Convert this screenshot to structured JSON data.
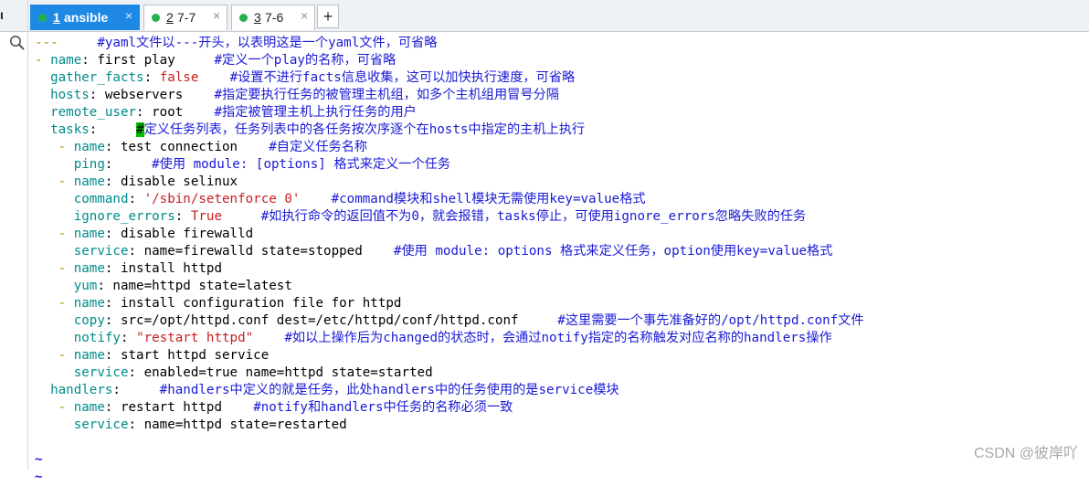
{
  "left_strip": {
    "cut_text": "ι"
  },
  "tabs": [
    {
      "num": "1",
      "label": "ansible",
      "close": "×",
      "active": true
    },
    {
      "num": "2",
      "label": "7-7",
      "close": "×",
      "active": false
    },
    {
      "num": "3",
      "label": "7-6",
      "close": "×",
      "active": false
    }
  ],
  "add_tab": "+",
  "editor": {
    "l01_dash": "---",
    "l01_cm": "     #yaml文件以---开头，以表明这是一个yaml文件，可省略",
    "l02_dash": "- ",
    "l02_key": "name",
    "l02_val": ": first play     ",
    "l02_cm": "#定义一个play的名称，可省略",
    "l03_key": "  gather_facts",
    "l03_colon": ": ",
    "l03_red": "false",
    "l03_cm": "    #设置不进行facts信息收集，这可以加快执行速度，可省略",
    "l04_key": "  hosts",
    "l04_val": ": webservers    ",
    "l04_cm": "#指定要执行任务的被管理主机组，如多个主机组用冒号分隔",
    "l05_key": "  remote_user",
    "l05_val": ": root    ",
    "l05_cm": "#指定被管理主机上执行任务的用户",
    "l06_key": "  tasks",
    "l06_val": ":     ",
    "l06_cursor": "#",
    "l06_cm": "定义任务列表，任务列表中的各任务按次序逐个在hosts中指定的主机上执行",
    "l07_dash": "   - ",
    "l07_key": "name",
    "l07_val": ": test connection    ",
    "l07_cm": "#自定义任务名称",
    "l08_key": "     ping",
    "l08_val": ":     ",
    "l08_cm": "#使用 module: [options] 格式来定义一个任务",
    "l09_dash": "   - ",
    "l09_key": "name",
    "l09_val": ": disable selinux",
    "l10_key": "     command",
    "l10_colon": ": ",
    "l10_red": "'/sbin/setenforce 0'",
    "l10_cm": "    #command模块和shell模块无需使用key=value格式",
    "l11_key": "     ignore_errors",
    "l11_colon": ": ",
    "l11_red": "True",
    "l11_cm": "     #如执行命令的返回值不为0，就会报错，tasks停止，可使用ignore_errors忽略失败的任务",
    "l12_dash": "   - ",
    "l12_key": "name",
    "l12_val": ": disable firewalld",
    "l13_key": "     service",
    "l13_val": ": name=firewalld state=stopped    ",
    "l13_cm": "#使用 module: options 格式来定义任务，option使用key=value格式",
    "l14_dash": "   - ",
    "l14_key": "name",
    "l14_val": ": install httpd",
    "l15_key": "     yum",
    "l15_val": ": name=httpd state=latest",
    "l16_dash": "   - ",
    "l16_key": "name",
    "l16_val": ": install configuration file for httpd",
    "l17_key": "     copy",
    "l17_val": ": src=/opt/httpd.conf dest=/etc/httpd/conf/httpd.conf     ",
    "l17_cm": "#这里需要一个事先准备好的/opt/httpd.conf文件",
    "l18_key": "     notify",
    "l18_colon": ": ",
    "l18_red": "\"restart httpd\"",
    "l18_cm": "    #如以上操作后为changed的状态时，会通过notify指定的名称触发对应名称的handlers操作",
    "l19_dash": "   - ",
    "l19_key": "name",
    "l19_val": ": start httpd service",
    "l20_key": "     service",
    "l20_val": ": enabled=true name=httpd state=started",
    "l21_key": "  handlers",
    "l21_val": ":     ",
    "l21_cm": "#handlers中定义的就是任务，此处handlers中的任务使用的是service模块",
    "l22_dash": "   - ",
    "l22_key": "name",
    "l22_val": ": restart httpd    ",
    "l22_cm": "#notify和handlers中任务的名称必须一致",
    "l23_key": "     service",
    "l23_val": ": name=httpd state=restarted",
    "l24": "",
    "tilde": "~"
  },
  "watermark": "CSDN @彼岸吖",
  "colors": {
    "tab_active": "#1e88e5",
    "key": "#008b8b",
    "comment": "#1a1ad6",
    "string": "#c81e1e",
    "cursor": "#00c000"
  }
}
